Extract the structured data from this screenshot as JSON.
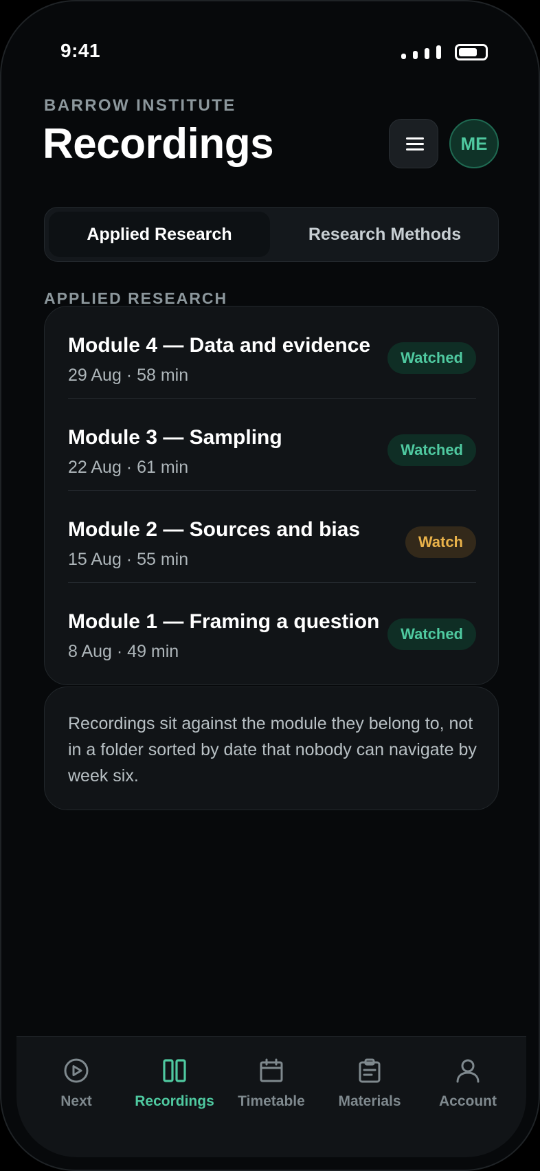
{
  "status_bar": {
    "time": "9:41"
  },
  "header": {
    "eyebrow": "BARROW INSTITUTE",
    "title": "Recordings",
    "avatar_initials": "ME"
  },
  "segments": [
    {
      "label": "Applied Research",
      "active": true
    },
    {
      "label": "Research Methods",
      "active": false
    }
  ],
  "section_label": "APPLIED RESEARCH",
  "recordings": [
    {
      "title": "Module 4 — Data and evidence",
      "meta": "29 Aug · 58 min",
      "status": "Watched"
    },
    {
      "title": "Module 3 — Sampling",
      "meta": "22 Aug · 61 min",
      "status": "Watched"
    },
    {
      "title": "Module 2 — Sources and bias",
      "meta": "15 Aug · 55 min",
      "status": "Watch"
    },
    {
      "title": "Module 1 — Framing a question",
      "meta": "8 Aug · 49 min",
      "status": "Watched"
    }
  ],
  "note": "Recordings sit against the module they belong to, not in a folder sorted by date that nobody can navigate by week six.",
  "tabbar": [
    {
      "label": "Next",
      "icon": "play-circle-icon",
      "active": false
    },
    {
      "label": "Recordings",
      "icon": "columns-icon",
      "active": true
    },
    {
      "label": "Timetable",
      "icon": "calendar-icon",
      "active": false
    },
    {
      "label": "Materials",
      "icon": "clipboard-icon",
      "active": false
    },
    {
      "label": "Account",
      "icon": "person-icon",
      "active": false
    }
  ],
  "colors": {
    "accent": "#4fc9a0",
    "watch": "#e9b24a",
    "background": "#07090b",
    "card": "#111417"
  }
}
